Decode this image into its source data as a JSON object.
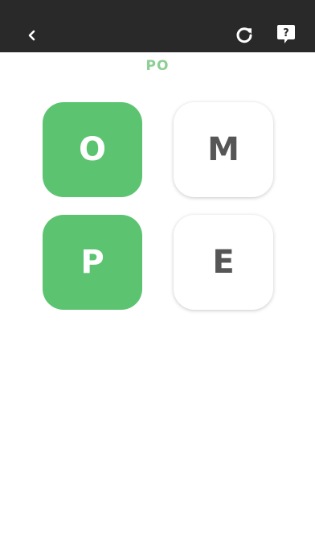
{
  "header": {
    "back_icon": "chevron-left-icon",
    "restart_icon": "restart-icon",
    "hint_icon": "question-bubble-icon"
  },
  "game": {
    "current_word": "PO",
    "tiles": [
      {
        "letter": "O",
        "selected": true
      },
      {
        "letter": "M",
        "selected": false
      },
      {
        "letter": "P",
        "selected": true
      },
      {
        "letter": "E",
        "selected": false
      }
    ]
  },
  "colors": {
    "topbar": "#292929",
    "selected_tile": "#5cc470",
    "word_text": "#8ccf92",
    "unselected_letter": "#565656"
  }
}
